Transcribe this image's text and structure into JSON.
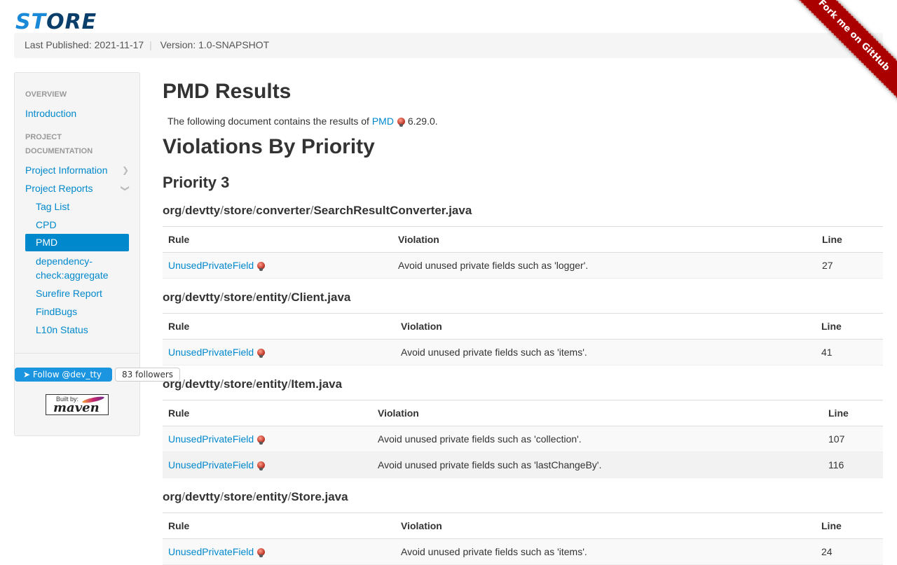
{
  "header": {
    "logo_part1": "ST",
    "logo_part2": "ORE",
    "last_published": "Last Published: 2021-11-17",
    "separator": "|",
    "version": "Version: 1.0-SNAPSHOT",
    "fork_ribbon": "Fork me on GitHub"
  },
  "sidebar": {
    "overview_header": "OVERVIEW",
    "introduction": "Introduction",
    "project_doc_header_1": "PROJECT",
    "project_doc_header_2": "DOCUMENTATION",
    "project_information": "Project Information",
    "project_reports": "Project Reports",
    "sub_items": [
      "Tag List",
      "CPD",
      "PMD",
      "dependency-",
      "check:aggregate",
      "Surefire Report",
      "FindBugs",
      "L10n Status"
    ],
    "twitter_follow": "Follow @dev_tty",
    "followers": "83 followers",
    "maven_by": "Built by:",
    "maven_name": "maven"
  },
  "main": {
    "title": "PMD Results",
    "intro_before": "The following document contains the results of ",
    "intro_link": "PMD",
    "intro_after": " 6.29.0.",
    "violations_title": "Violations By Priority",
    "priority_title": "Priority 3",
    "columns": {
      "rule": "Rule",
      "violation": "Violation",
      "line": "Line"
    },
    "files": [
      {
        "path": [
          "org",
          "devtty",
          "store",
          "converter",
          "SearchResultConverter.java"
        ],
        "rows": [
          {
            "rule": "UnusedPrivateField",
            "violation": "Avoid unused private fields such as 'logger'.",
            "line": "27"
          }
        ]
      },
      {
        "path": [
          "org",
          "devtty",
          "store",
          "entity",
          "Client.java"
        ],
        "rows": [
          {
            "rule": "UnusedPrivateField",
            "violation": "Avoid unused private fields such as 'items'.",
            "line": "41"
          }
        ]
      },
      {
        "path": [
          "org",
          "devtty",
          "store",
          "entity",
          "Item.java"
        ],
        "rows": [
          {
            "rule": "UnusedPrivateField",
            "violation": "Avoid unused private fields such as 'collection'.",
            "line": "107"
          },
          {
            "rule": "UnusedPrivateField",
            "violation": "Avoid unused private fields such as 'lastChangeBy'.",
            "line": "116"
          }
        ]
      },
      {
        "path": [
          "org",
          "devtty",
          "store",
          "entity",
          "Store.java"
        ],
        "rows": [
          {
            "rule": "UnusedPrivateField",
            "violation": "Avoid unused private fields such as 'items'.",
            "line": "24"
          }
        ]
      }
    ],
    "path_separator": "/"
  },
  "colors": {
    "link": "#0088cc",
    "active_bg": "#0088cc",
    "ribbon": "#aa0000",
    "twitter": "#1b95e0"
  },
  "icons": {
    "pmd": "pmd-rule-icon",
    "chevron_right": "chevron-right-icon",
    "chevron_down": "chevron-down-icon",
    "twitter": "twitter-bird-icon"
  }
}
